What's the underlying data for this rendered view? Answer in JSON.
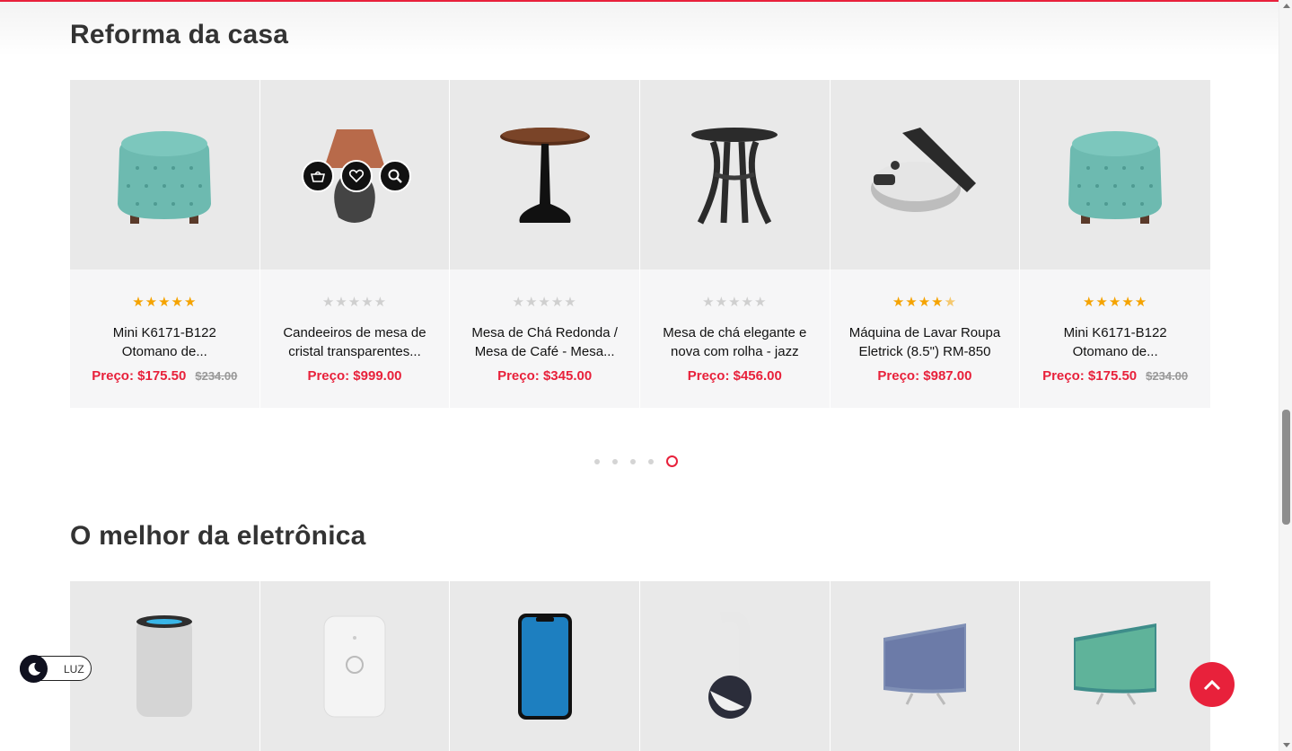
{
  "sections": [
    {
      "title": "Reforma da casa",
      "products": [
        {
          "image": "teal-tufted-ottoman",
          "rating": 5,
          "name": "Mini K6171-B122 Otomano de...",
          "price": "Preço: $175.50",
          "old_price": "$234.00"
        },
        {
          "image": "copper-table-lamp",
          "rating": 0,
          "name": "Candeeiros de mesa de cristal transparentes...",
          "price": "Preço: $999.00",
          "old_price": ""
        },
        {
          "image": "round-coffee-table",
          "rating": 0,
          "name": "Mesa de Chá Redonda / Mesa de Café - Mesa...",
          "price": "Preço: $345.00",
          "old_price": ""
        },
        {
          "image": "dark-tea-table",
          "rating": 0,
          "name": "Mesa de chá elegante e nova com rolha - jazz",
          "price": "Preço: $456.00",
          "old_price": ""
        },
        {
          "image": "roti-maker",
          "rating": 4.5,
          "name": "Máquina de Lavar Roupa Eletrick (8.5\") RM-850",
          "price": "Preço: $987.00",
          "old_price": ""
        },
        {
          "image": "teal-tufted-ottoman",
          "rating": 5,
          "name": "Mini K6171-B122 Otomano de...",
          "price": "Preço: $175.50",
          "old_price": "$234.00"
        }
      ]
    },
    {
      "title": "O melhor da eletrônica",
      "products": [
        {
          "image": "smart-speaker"
        },
        {
          "image": "wifi-router"
        },
        {
          "image": "smartphone"
        },
        {
          "image": "headset"
        },
        {
          "image": "curved-tv"
        },
        {
          "image": "curved-tv-green"
        }
      ]
    }
  ],
  "hover_actions": [
    "basket-icon",
    "heart-icon",
    "search-icon"
  ],
  "carousel": {
    "dots": 5,
    "active": 5
  },
  "theme_toggle": {
    "label": "LUZ",
    "icon": "moon-icon"
  },
  "colors": {
    "accent": "#e8213b",
    "star": "#f5a300",
    "card_bg": "#f6f6f7",
    "image_bg": "#e9e9e9"
  }
}
